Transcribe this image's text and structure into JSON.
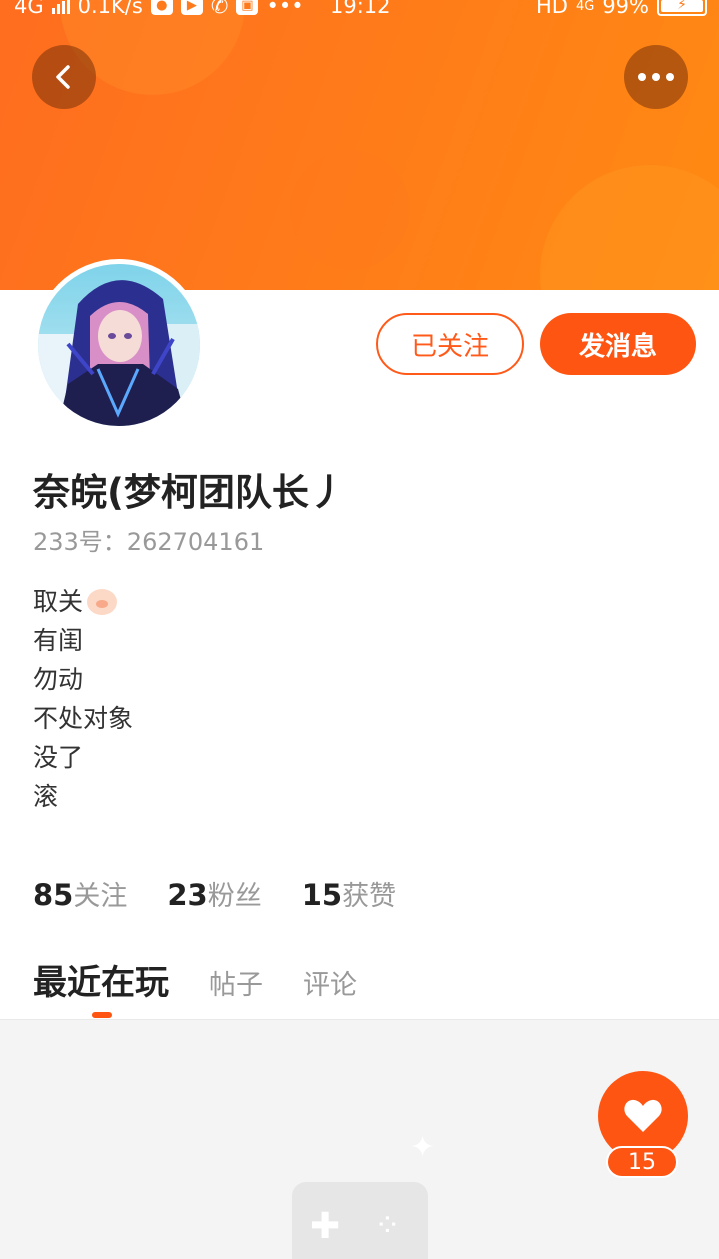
{
  "status_bar": {
    "network": "4G",
    "speed": "0.1K/s",
    "time": "19:12",
    "hd": "HD",
    "net_type": "4G",
    "battery": "99%"
  },
  "header": {
    "back_icon": "chevron-left-icon",
    "more_icon": "more-horizontal-icon"
  },
  "profile": {
    "name": "奈皖(梦柯团队长丿",
    "id_label": "233号：262704161",
    "followed_label": "已关注",
    "message_label": "发消息",
    "bio": [
      "取关",
      "有闺",
      "勿动",
      "不处对象",
      "没了",
      "滚"
    ]
  },
  "stats": {
    "following_count": "85",
    "following_label": "关注",
    "fans_count": "23",
    "fans_label": "粉丝",
    "likes_count": "15",
    "likes_label": "获赞"
  },
  "tabs": {
    "recent": "最近在玩",
    "posts": "帖子",
    "comments": "评论"
  },
  "like_fab": {
    "icon": "heart-icon",
    "count": "15"
  },
  "colors": {
    "accent": "#ff5512",
    "banner": "#ff7a1a"
  }
}
